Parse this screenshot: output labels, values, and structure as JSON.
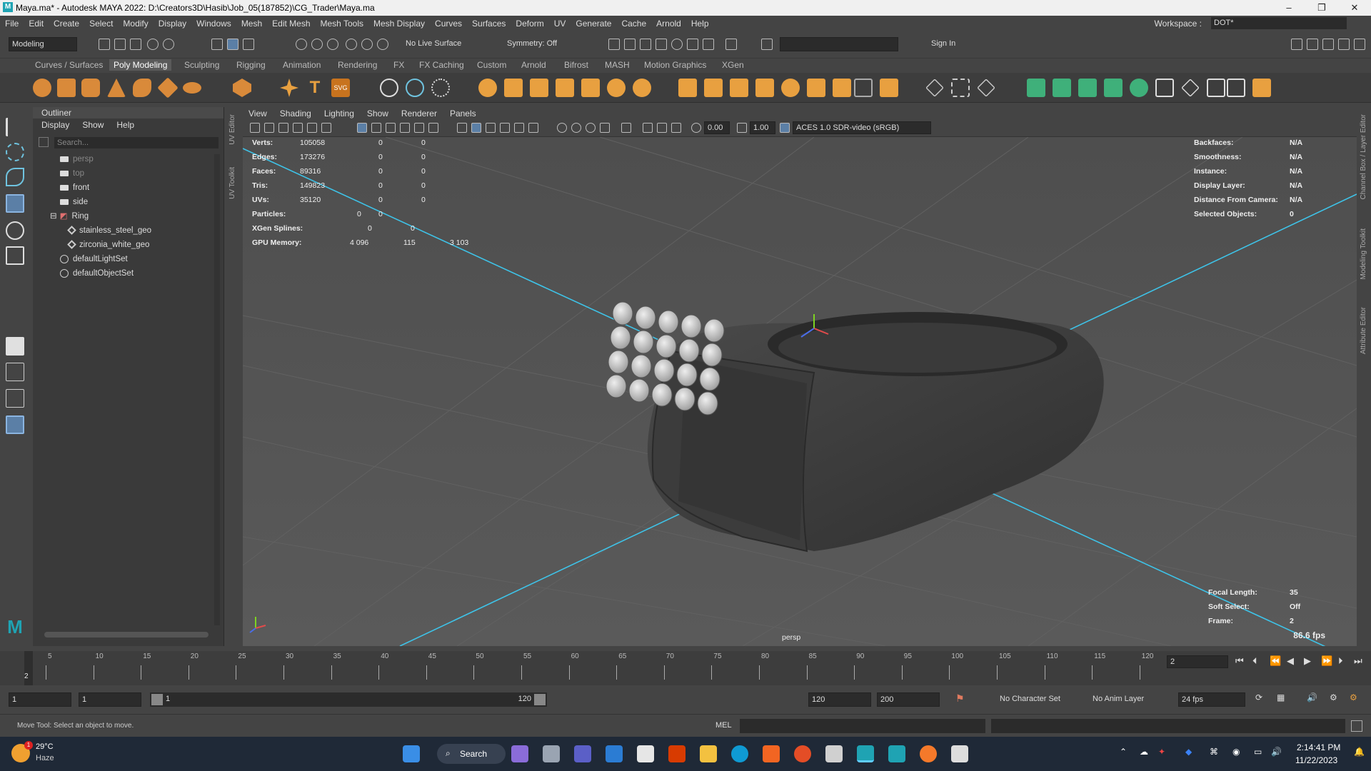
{
  "window": {
    "title": "Maya.ma* - Autodesk MAYA 2022: D:\\Creators3D\\Hasib\\Job_05(187852)\\CG_Trader\\Maya.ma"
  },
  "menu": [
    "File",
    "Edit",
    "Create",
    "Select",
    "Modify",
    "Display",
    "Windows",
    "Mesh",
    "Edit Mesh",
    "Mesh Tools",
    "Mesh Display",
    "Curves",
    "Surfaces",
    "Deform",
    "UV",
    "Generate",
    "Cache",
    "Arnold",
    "Help"
  ],
  "workspace": {
    "label": "Workspace :",
    "value": "DOT*"
  },
  "statusline": {
    "mode": "Modeling",
    "live_surface": "No Live Surface",
    "symmetry": "Symmetry: Off",
    "sign_in": "Sign In"
  },
  "shelf_tabs": [
    "Curves / Surfaces",
    "Poly Modeling",
    "Sculpting",
    "Rigging",
    "Animation",
    "Rendering",
    "FX",
    "FX Caching",
    "Custom",
    "Arnold",
    "Bifrost",
    "MASH",
    "Motion Graphics",
    "XGen"
  ],
  "shelf_active": "Poly Modeling",
  "outliner": {
    "title": "Outliner",
    "menu": [
      "Display",
      "Show",
      "Help"
    ],
    "search_placeholder": "Search...",
    "items": [
      {
        "label": "persp",
        "type": "camera",
        "dim": true
      },
      {
        "label": "top",
        "type": "camera",
        "dim": true
      },
      {
        "label": "front",
        "type": "camera",
        "dim": false
      },
      {
        "label": "side",
        "type": "camera",
        "dim": false
      },
      {
        "label": "Ring",
        "type": "group",
        "dim": false
      },
      {
        "label": "stainless_steel_geo",
        "type": "mesh",
        "dim": false
      },
      {
        "label": "zirconia_white_geo",
        "type": "mesh",
        "dim": false
      },
      {
        "label": "defaultLightSet",
        "type": "set",
        "dim": false
      },
      {
        "label": "defaultObjectSet",
        "type": "set",
        "dim": false
      }
    ]
  },
  "side_tabs": [
    "UV Editor",
    "UV Toolkit"
  ],
  "right_tabs": [
    "Channel Box / Layer Editor",
    "Modeling Toolkit",
    "Attribute Editor"
  ],
  "panel_menu": [
    "View",
    "Shading",
    "Lighting",
    "Show",
    "Renderer",
    "Panels"
  ],
  "panel_toolbar": {
    "exposure": "0.00",
    "gamma": "1.00",
    "colorspace": "ACES 1.0 SDR-video (sRGB)"
  },
  "hud_left": [
    {
      "label": "Verts:",
      "v1": "105058",
      "v2": "0",
      "v3": "0"
    },
    {
      "label": "Edges:",
      "v1": "173276",
      "v2": "0",
      "v3": "0"
    },
    {
      "label": "Faces:",
      "v1": "89316",
      "v2": "0",
      "v3": "0"
    },
    {
      "label": "Tris:",
      "v1": "149823",
      "v2": "0",
      "v3": "0"
    },
    {
      "label": "UVs:",
      "v1": "35120",
      "v2": "0",
      "v3": "0"
    },
    {
      "label": "Particles:",
      "v1": "0",
      "v2": "0",
      "v3": ""
    },
    {
      "label": "XGen Splines:",
      "v1": "0",
      "v2": "0",
      "v3": ""
    },
    {
      "label": "GPU Memory:",
      "v1": "4 096",
      "v2": "115",
      "v3": "3 103"
    }
  ],
  "hud_right": [
    {
      "label": "Backfaces:",
      "value": "N/A"
    },
    {
      "label": "Smoothness:",
      "value": "N/A"
    },
    {
      "label": "Instance:",
      "value": "N/A"
    },
    {
      "label": "Display Layer:",
      "value": "N/A"
    },
    {
      "label": "Distance From Camera:",
      "value": "N/A"
    },
    {
      "label": "Selected Objects:",
      "value": "0"
    }
  ],
  "hud_bottom": [
    {
      "label": "Focal Length:",
      "value": "35"
    },
    {
      "label": "Soft Select:",
      "value": "Off"
    },
    {
      "label": "Frame:",
      "value": "2"
    }
  ],
  "fps": "86.6 fps",
  "camera_label": "persp",
  "timeline": {
    "ticks": [
      "5",
      "10",
      "15",
      "20",
      "25",
      "30",
      "35",
      "40",
      "45",
      "50",
      "55",
      "60",
      "65",
      "70",
      "75",
      "80",
      "85",
      "90",
      "95",
      "100",
      "105",
      "110",
      "115",
      "120"
    ],
    "current": "2",
    "current_field": "2"
  },
  "range": {
    "start": "1",
    "anim_start": "1",
    "slider_start": "1",
    "slider_end": "120",
    "end": "120",
    "anim_end": "200",
    "character": "No Character Set",
    "anim_layer": "No Anim Layer",
    "fps": "24 fps"
  },
  "helpline": {
    "text": "Move Tool: Select an object to move.",
    "lang": "MEL"
  },
  "taskbar": {
    "temp": "29°C",
    "weather": "Haze",
    "search": "Search",
    "time": "2:14:41 PM",
    "date": "11/22/2023",
    "badge": "1"
  }
}
